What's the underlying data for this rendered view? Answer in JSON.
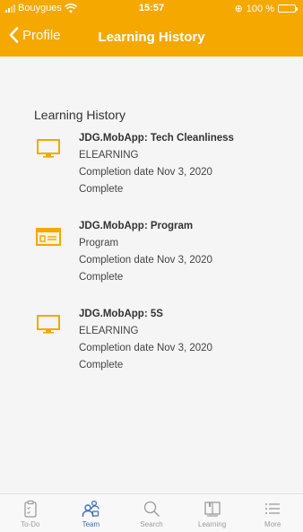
{
  "status_bar": {
    "carrier": "Bouygues",
    "time": "15:57",
    "battery": "100 %"
  },
  "nav": {
    "back_label": "Profile",
    "title": "Learning History"
  },
  "section": {
    "title": "Learning History"
  },
  "items": [
    {
      "icon": "monitor-icon",
      "title": "JDG.MobApp: Tech Cleanliness",
      "type": "ELEARNING",
      "completion": "Completion date Nov 3, 2020",
      "status": "Complete"
    },
    {
      "icon": "program-icon",
      "title": "JDG.MobApp: Program",
      "type": "Program",
      "completion": "Completion date Nov 3, 2020",
      "status": "Complete"
    },
    {
      "icon": "monitor-icon",
      "title": "JDG.MobApp: 5S",
      "type": "ELEARNING",
      "completion": "Completion date Nov 3, 2020",
      "status": "Complete"
    }
  ],
  "tabs": [
    {
      "label": "To-Do",
      "icon": "clipboard-icon",
      "active": false
    },
    {
      "label": "Team",
      "icon": "team-icon",
      "active": true
    },
    {
      "label": "Search",
      "icon": "search-icon",
      "active": false
    },
    {
      "label": "Learning",
      "icon": "book-icon",
      "active": false
    },
    {
      "label": "More",
      "icon": "list-icon",
      "active": false
    }
  ],
  "colors": {
    "header": "#f5a800",
    "accent": "#3d6fb6",
    "icon_orange": "#f5a800"
  }
}
